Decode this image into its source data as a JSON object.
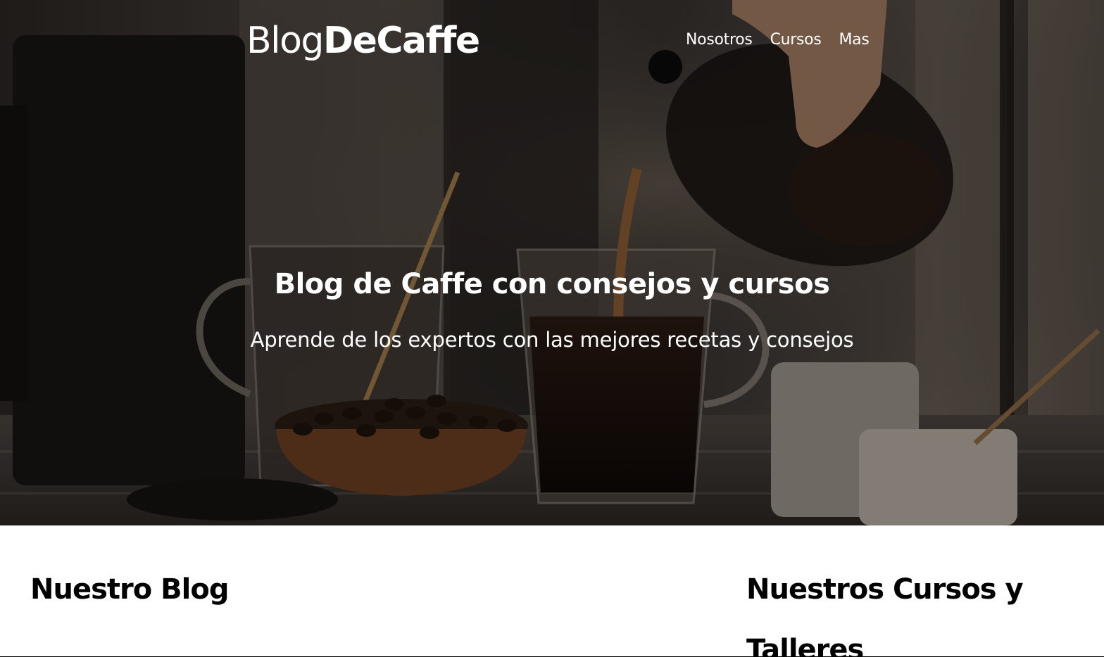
{
  "header": {
    "logo_light": "Blog",
    "logo_bold": "DeCaffe",
    "nav": [
      {
        "label": "Nosotros"
      },
      {
        "label": "Cursos"
      },
      {
        "label": "Mas"
      }
    ]
  },
  "hero": {
    "title": "Blog de Caffe con consejos y cursos",
    "subtitle": "Aprende de los expertos con las mejores recetas y consejos"
  },
  "sections": {
    "blog_heading": "Nuestro Blog",
    "courses_heading": "Nuestros Cursos y Talleres"
  },
  "colors": {
    "hero_text": "#ffffff",
    "heading_text": "#000000",
    "background": "#ffffff"
  }
}
